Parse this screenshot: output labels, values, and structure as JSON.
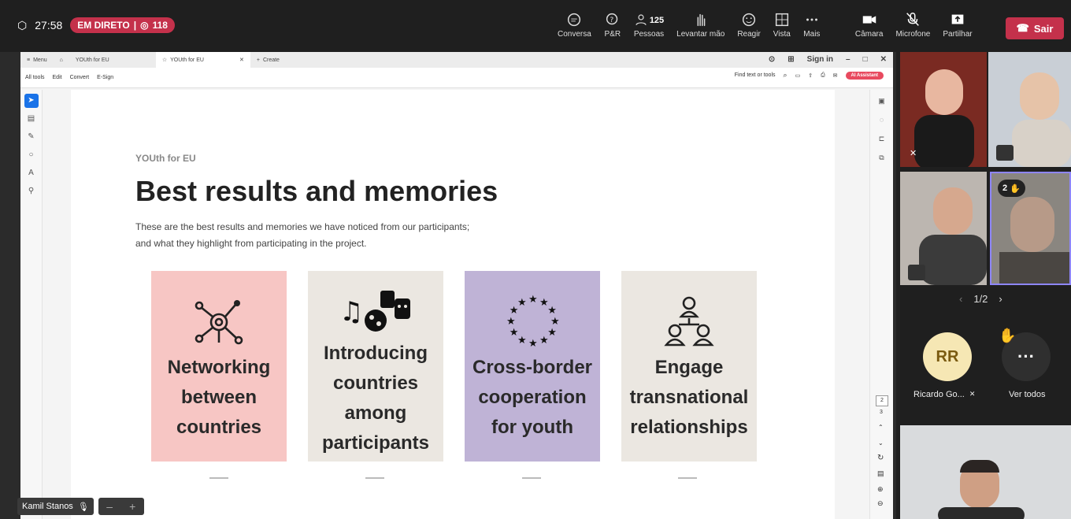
{
  "meeting": {
    "timer": "27:58",
    "live_label": "EM DIRETO",
    "viewers": "118",
    "toolbar": [
      {
        "label": "Conversa",
        "icon": "chat-icon"
      },
      {
        "label": "P&R",
        "icon": "qa-icon"
      },
      {
        "label": "Pessoas",
        "icon": "people-icon",
        "count": "125"
      },
      {
        "label": "Levantar mão",
        "icon": "raise-hand-icon"
      },
      {
        "label": "Reagir",
        "icon": "react-icon"
      },
      {
        "label": "Vista",
        "icon": "view-icon"
      },
      {
        "label": "Mais",
        "icon": "more-icon"
      }
    ],
    "controls": [
      {
        "label": "Câmara",
        "icon": "camera-icon"
      },
      {
        "label": "Microfone",
        "icon": "mic-off-icon"
      },
      {
        "label": "Partilhar",
        "icon": "share-icon"
      }
    ],
    "leave_label": "Sair",
    "presenter_name": "Kamil Stanos",
    "pager": "1/2",
    "hand_count": "2",
    "participant_initials": "RR",
    "participant_name": "Ricardo Go...",
    "see_all_label": "Ver todos"
  },
  "browser": {
    "tabs": [
      {
        "label": "Menu"
      },
      {
        "label": "YOUth for EU"
      },
      {
        "label": "YOUth for EU"
      },
      {
        "label": "Create"
      }
    ],
    "sign_in": "Sign in",
    "menu": [
      "All tools",
      "Edit",
      "Convert",
      "E-Sign"
    ],
    "find_label": "Find text or tools",
    "ai_label": "AI Assistant",
    "page_number": "2",
    "page_next": "3"
  },
  "slide": {
    "kicker": "YOUth for EU",
    "title": "Best results and memories",
    "desc_line1": "These are the best results and memories we have noticed from our participants;",
    "desc_line2": "and what they highlight from participating in the project.",
    "cards": [
      {
        "text": [
          "Networking",
          "between",
          "countries"
        ],
        "color": "#f7c6c4",
        "icon": "network-icon"
      },
      {
        "text": [
          "Introducing",
          "countries",
          "among",
          "participants"
        ],
        "color": "#ebe7e1",
        "icon": "culture-icon"
      },
      {
        "text": [
          "Cross-border",
          "cooperation",
          "for youth"
        ],
        "color": "#bfb3d6",
        "icon": "eu-stars-icon"
      },
      {
        "text": [
          "Engage",
          "transnational",
          "relationships"
        ],
        "color": "#ebe7e1",
        "icon": "relationships-icon"
      }
    ]
  }
}
